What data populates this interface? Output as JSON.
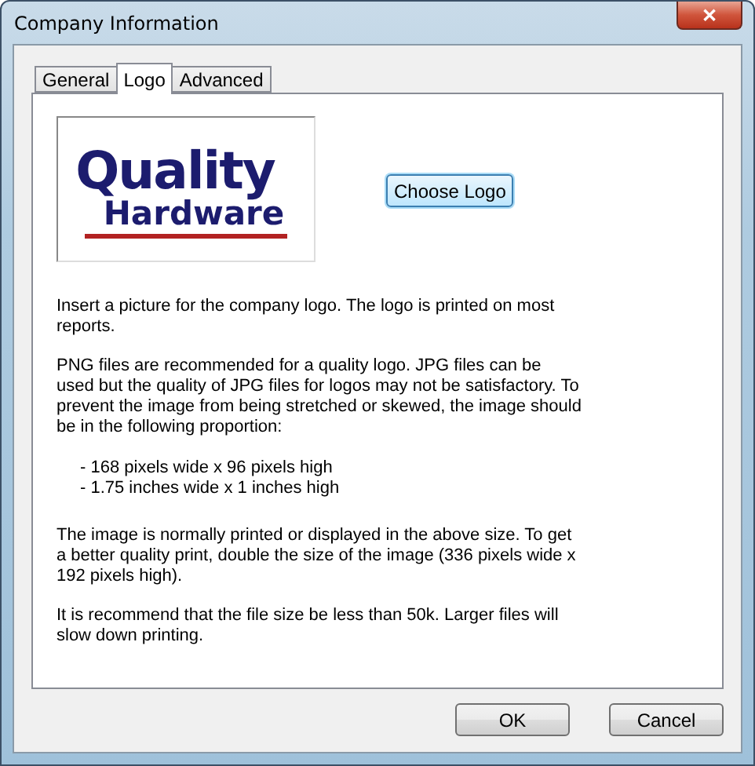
{
  "window": {
    "title": "Company Information",
    "close": "✕"
  },
  "tabs": [
    {
      "label": "General",
      "selected": false
    },
    {
      "label": "Logo",
      "selected": true
    },
    {
      "label": "Advanced",
      "selected": false
    }
  ],
  "logo_preview": {
    "lines": [
      "Quality",
      "Hardware"
    ]
  },
  "choose_button": "Choose Logo",
  "paragraphs": [
    "Insert a picture for the company logo.  The logo is printed on most reports.",
    "PNG files are recommended for a quality logo.  JPG files can be used but the quality of JPG files for logos may not be satisfactory.  To prevent the image from being stretched or skewed, the image should be in the following proportion:"
  ],
  "proportions": [
    "- 168 pixels wide x 96 pixels high",
    "- 1.75 inches wide x 1 inches high"
  ],
  "notes": [
    "The image is normally printed or displayed in the above size.  To get a better quality print, double the size of the image (336 pixels wide x 192 pixels high).",
    "It is recommend that the file size be less than 50k.  Larger files will slow down printing."
  ],
  "buttons": [
    "OK",
    "Cancel"
  ]
}
